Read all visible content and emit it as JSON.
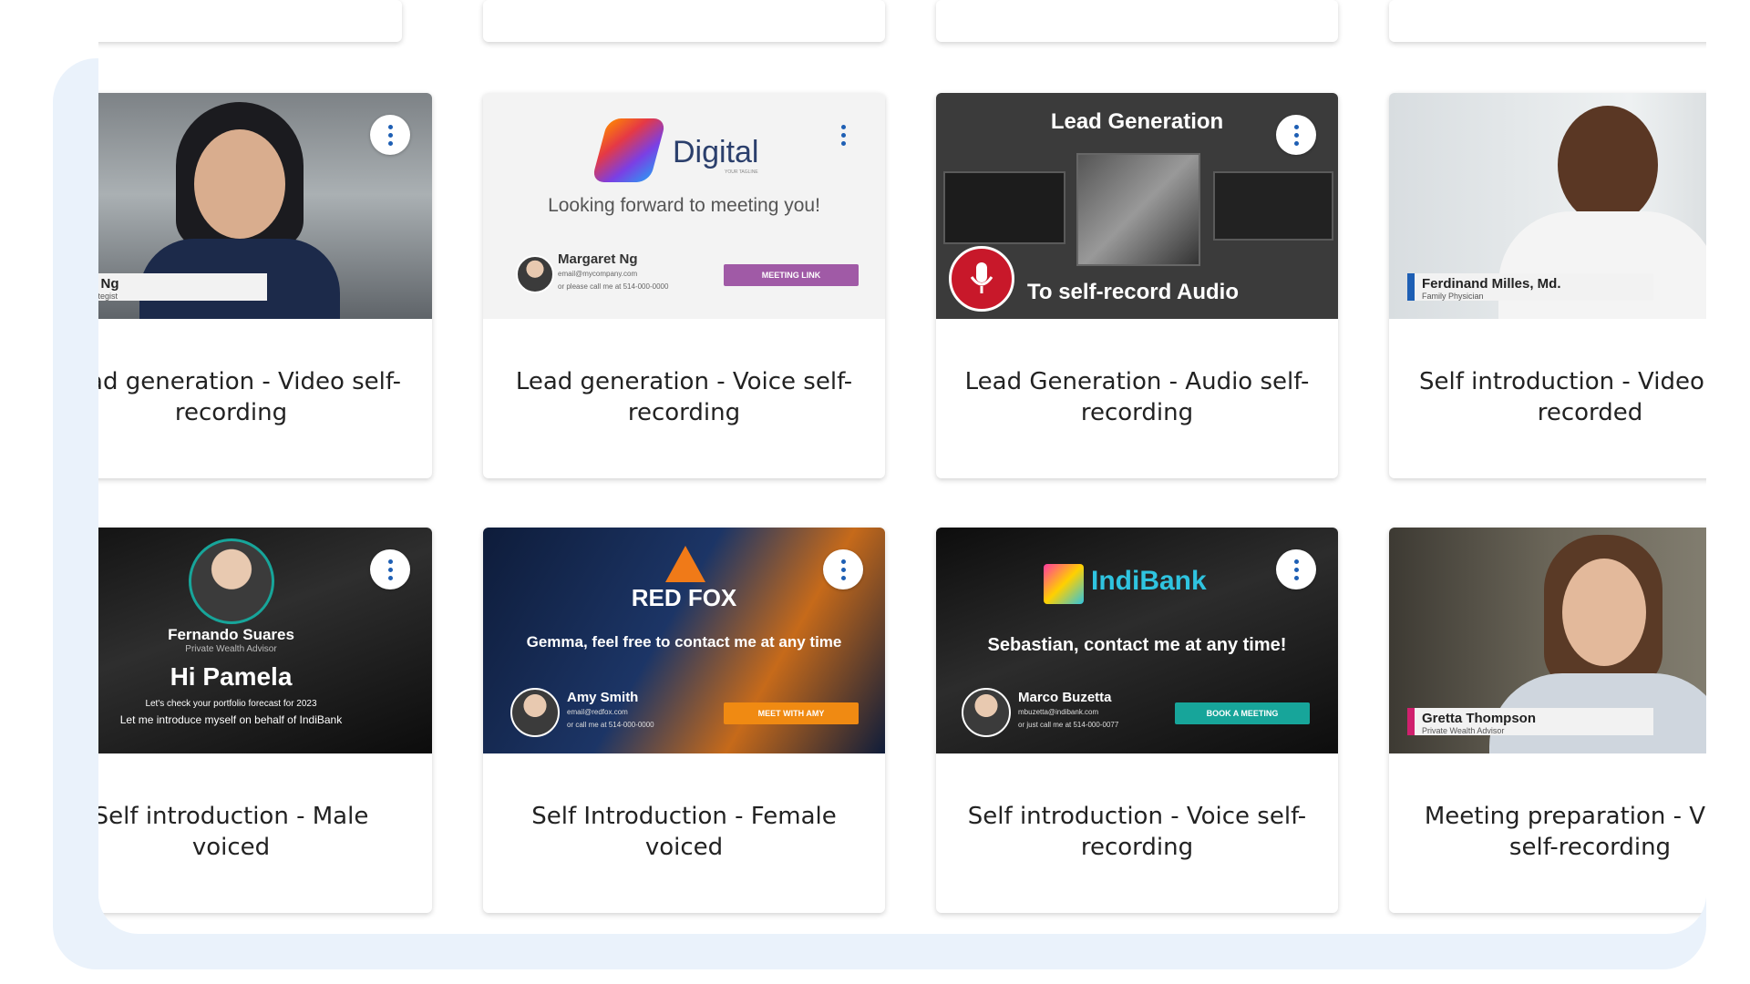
{
  "cards": [
    {
      "title": "Lead generation - Video self-recording",
      "overlay_name": "Margaret Ng",
      "overlay_role": "Automation Strategist"
    },
    {
      "title": "Lead generation - Voice self-recording",
      "brand": "Digital",
      "brand_tagline": "YOUR TAGLINE",
      "headline": "Looking forward to meeting you!",
      "sig_name": "Margaret Ng",
      "sig_line1": "email@mycompany.com",
      "sig_line2": "or please call me at 514-000-0000",
      "cta": "MEETING LINK"
    },
    {
      "title": "Lead Generation - Audio self-recording",
      "top_text": "Lead Generation",
      "bottom_text": "To self-record Audio"
    },
    {
      "title": "Self introduction - Video self-recorded",
      "overlay_name": "Ferdinand Milles, Md.",
      "overlay_role": "Family Physician"
    },
    {
      "title": "Self introduction - Male voiced",
      "person_name": "Fernando Suares",
      "person_role": "Private Wealth Advisor",
      "greeting": "Hi Pamela",
      "line1": "Let's check your portfolio forecast for 2023",
      "line2": "Let me introduce myself on behalf of IndiBank"
    },
    {
      "title": "Self Introduction - Female voiced",
      "brand": "RED FOX",
      "headline": "Gemma, feel free to contact me at any time",
      "sig_name": "Amy Smith",
      "sig_line1": "email@redfox.com",
      "sig_line2": "or call me at 514-000-0000",
      "cta": "MEET WITH AMY"
    },
    {
      "title": "Self introduction - Voice self-recording",
      "brand": "IndiBank",
      "headline": "Sebastian, contact me at any time!",
      "sig_name": "Marco Buzetta",
      "sig_line1": "mbuzetta@indibank.com",
      "sig_line2": "or just call me at 514-000-0077",
      "cta": "BOOK A MEETING"
    },
    {
      "title": "Meeting preparation - Video self-recording",
      "overlay_name": "Gretta Thompson",
      "overlay_role": "Private Wealth Advisor"
    }
  ],
  "colors": {
    "accent": "#1e5fb4",
    "panel": "#eaf2fb",
    "digital_cta": "#a05aa6",
    "redfox_cta": "#f08a12",
    "indibank_cta": "#17a59a",
    "indibank_text": "#2fc4e0"
  },
  "icons": {
    "menu": "more-vertical-icon",
    "mic": "microphone-icon"
  }
}
